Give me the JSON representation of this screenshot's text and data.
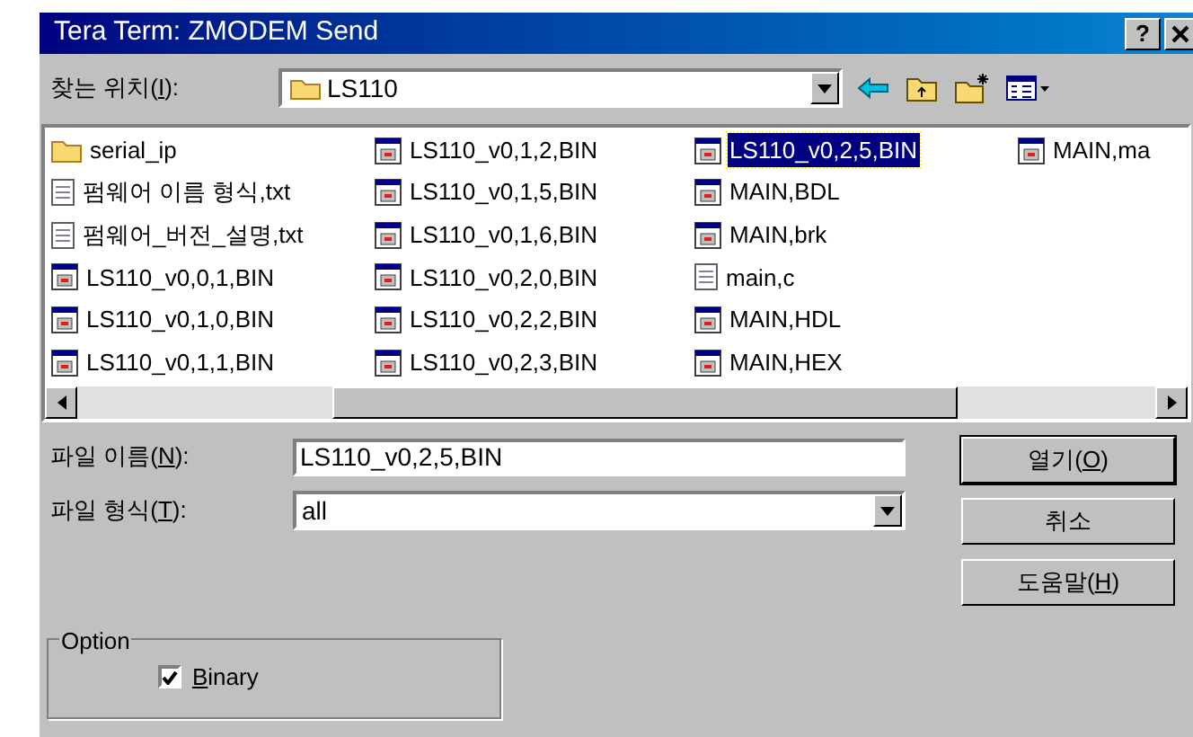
{
  "window": {
    "title": "Tera Term: ZMODEM Send",
    "help_button": "?"
  },
  "look_in": {
    "label": {
      "before": "찾는 위치(",
      "key": "I",
      "after": "):"
    },
    "value": "LS110"
  },
  "files": [
    {
      "name": "serial_ip",
      "kind": "folder",
      "selected": false
    },
    {
      "name": "펌웨어 이름 형식,txt",
      "kind": "text",
      "selected": false
    },
    {
      "name": "펌웨어_버전_설명,txt",
      "kind": "text",
      "selected": false
    },
    {
      "name": "LS110_v0,0,1,BIN",
      "kind": "binary",
      "selected": false
    },
    {
      "name": "LS110_v0,1,0,BIN",
      "kind": "binary",
      "selected": false
    },
    {
      "name": "LS110_v0,1,1,BIN",
      "kind": "binary",
      "selected": false
    },
    {
      "name": "LS110_v0,1,2,BIN",
      "kind": "binary",
      "selected": false
    },
    {
      "name": "LS110_v0,1,5,BIN",
      "kind": "binary",
      "selected": false
    },
    {
      "name": "LS110_v0,1,6,BIN",
      "kind": "binary",
      "selected": false
    },
    {
      "name": "LS110_v0,2,0,BIN",
      "kind": "binary",
      "selected": false
    },
    {
      "name": "LS110_v0,2,2,BIN",
      "kind": "binary",
      "selected": false
    },
    {
      "name": "LS110_v0,2,3,BIN",
      "kind": "binary",
      "selected": false
    },
    {
      "name": "LS110_v0,2,5,BIN",
      "kind": "binary",
      "selected": true
    },
    {
      "name": "MAIN,BDL",
      "kind": "binary",
      "selected": false
    },
    {
      "name": "MAIN,brk",
      "kind": "binary",
      "selected": false
    },
    {
      "name": "main,c",
      "kind": "text",
      "selected": false
    },
    {
      "name": "MAIN,HDL",
      "kind": "binary",
      "selected": false
    },
    {
      "name": "MAIN,HEX",
      "kind": "binary",
      "selected": false
    },
    {
      "name": "MAIN,ma",
      "kind": "binary",
      "selected": false
    }
  ],
  "file_name": {
    "label": {
      "before": "파일 이름(",
      "key": "N",
      "after": "):"
    },
    "value": "LS110_v0,2,5,BIN"
  },
  "file_type": {
    "label": {
      "before": "파일 형식(",
      "key": "T",
      "after": "):"
    },
    "value": "all"
  },
  "buttons": [
    {
      "before": "열기(",
      "key": "O",
      "after": ")",
      "default": true
    },
    {
      "before": "취소",
      "default": false
    },
    {
      "before": "도움말(",
      "key": "H",
      "after": ")",
      "default": false
    }
  ],
  "option": {
    "legend": "Option",
    "binary": {
      "label": {
        "key": "B",
        "after": "inary"
      },
      "checked": true
    }
  }
}
